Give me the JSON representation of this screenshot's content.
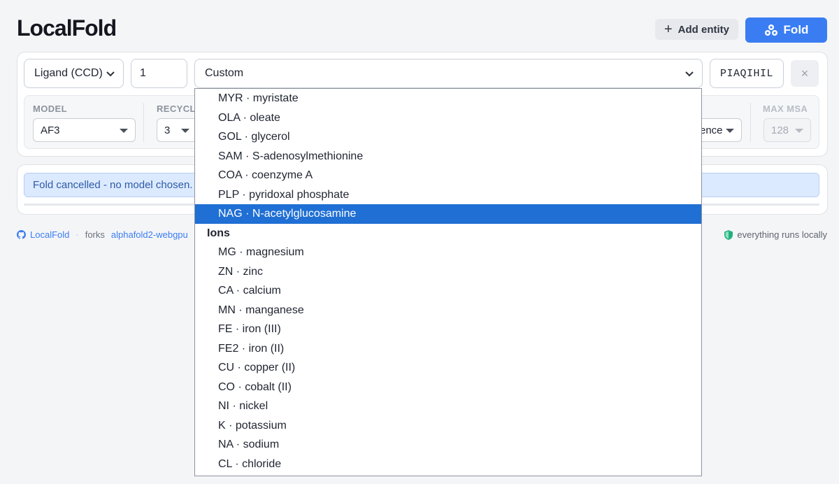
{
  "header": {
    "app_title": "LocalFold",
    "add_entity_label": "Add entity",
    "fold_label": "Fold"
  },
  "entity": {
    "type_value": "Ligand (CCD)",
    "copies_value": "1",
    "ccd_select_value": "Custom",
    "ccd_code_value": "PIAQIHIL",
    "remove_label": "×"
  },
  "options": {
    "model": {
      "label": "MODEL",
      "value": "AF3"
    },
    "recycles": {
      "label": "RECYCL",
      "value": "3"
    },
    "msa_mode": {
      "value": "ence"
    },
    "max_msa": {
      "label": "MAX MSA",
      "value": "128",
      "disabled": true
    }
  },
  "status": {
    "message": "Fold cancelled - no model chosen."
  },
  "footer": {
    "repo_label": "LocalFold",
    "forks_label": "forks",
    "fork_link": "alphafold2-webgpu",
    "local_note": "everything runs locally"
  },
  "dropdown": {
    "items_before": [
      "MYR · myristate",
      "OLA · oleate",
      "GOL · glycerol",
      "SAM · S-adenosylmethionine",
      "COA · coenzyme A",
      "PLP · pyridoxal phosphate"
    ],
    "selected": "NAG · N-acetylglucosamine",
    "group_label": "Ions",
    "ions": [
      "MG · magnesium",
      "ZN · zinc",
      "CA · calcium",
      "MN · manganese",
      "FE · iron (III)",
      "FE2 · iron (II)",
      "CU · copper (II)",
      "CO · cobalt (II)",
      "NI · nickel",
      "K · potassium",
      "NA · sodium",
      "CL · chloride"
    ]
  },
  "colors": {
    "accent": "#3a7df3",
    "selected_option": "#1f6fd4",
    "status_bg": "#dceaff",
    "shield": "#22b07d"
  },
  "icons": {
    "add": "plus-icon",
    "fold": "molecule-icon",
    "github": "github-icon",
    "shield": "shield-icon"
  }
}
